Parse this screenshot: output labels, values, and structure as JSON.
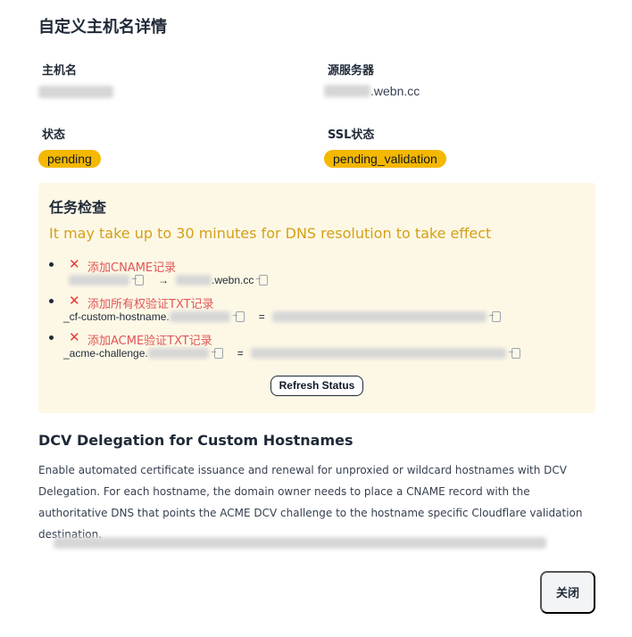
{
  "dialog": {
    "title": "自定义主机名详情"
  },
  "fields": {
    "hostname_label": "主机名",
    "origin_label": "源服务器",
    "origin_suffix": ".webn.cc",
    "status_label": "状态",
    "status_value": "pending",
    "ssl_label": "SSL状态",
    "ssl_value": "pending_validation"
  },
  "tasks": {
    "title": "任务检查",
    "note": "It may take up to 30 minutes for DNS resolution to take effect",
    "items": [
      {
        "label": "添加CNAME记录",
        "arrow": "→",
        "target_suffix": ".webn.cc",
        "status": "failed"
      },
      {
        "label": "添加所有权验证TXT记录",
        "name_prefix": "_cf-custom-hostname.",
        "equals": "=",
        "status": "failed"
      },
      {
        "label": "添加ACME验证TXT记录",
        "name_prefix": "_acme-challenge.",
        "equals": "=",
        "status": "failed"
      }
    ],
    "status_icon": "x-icon",
    "refresh_label": "Refresh Status"
  },
  "dcv": {
    "title": "DCV Delegation for Custom Hostnames",
    "description": "Enable automated certificate issuance and renewal for unproxied or wildcard hostnames with DCV Delegation. For each hostname, the domain owner needs to place a CNAME record with the authoritative DNS that points the ACME DCV challenge to the hostname specific Cloudflare validation destination."
  },
  "footer": {
    "close_label": "关闭"
  },
  "colors": {
    "badge": "#f5b800",
    "task_panel_bg": "#fdf8e6",
    "note": "#d4a017",
    "error": "#e05656"
  }
}
